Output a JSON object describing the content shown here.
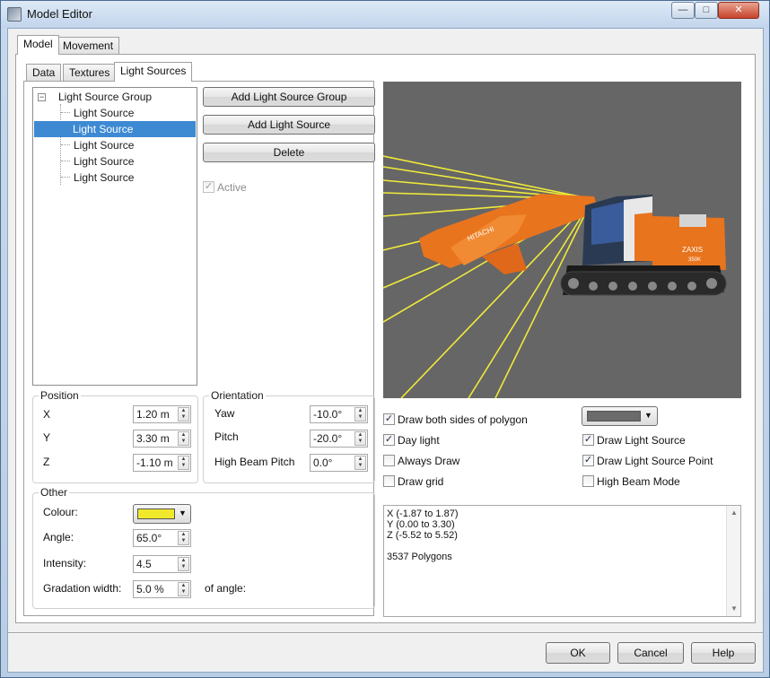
{
  "window": {
    "title": "Model Editor",
    "minimize_glyph": "—",
    "maximize_glyph": "□",
    "close_glyph": "✕"
  },
  "top_tabs": [
    {
      "label": "Model",
      "active": true
    },
    {
      "label": "Movement",
      "active": false
    }
  ],
  "sub_tabs": [
    {
      "label": "Data",
      "active": false
    },
    {
      "label": "Textures",
      "active": false
    },
    {
      "label": "Light Sources",
      "active": true
    }
  ],
  "tree": {
    "root": "Light Source Group",
    "items": [
      "Light Source",
      "Light Source",
      "Light Source",
      "Light Source",
      "Light Source"
    ],
    "selected_index": 1
  },
  "actions": {
    "add_group": "Add Light Source Group",
    "add_source": "Add Light Source",
    "delete": "Delete",
    "active_label": "Active",
    "active_checked": true
  },
  "position": {
    "title": "Position",
    "fields": [
      {
        "label": "X",
        "value": "1.20 m"
      },
      {
        "label": "Y",
        "value": "3.30 m"
      },
      {
        "label": "Z",
        "value": "-1.10 m"
      }
    ]
  },
  "orientation": {
    "title": "Orientation",
    "fields": [
      {
        "label": "Yaw",
        "value": "-10.0°"
      },
      {
        "label": "Pitch",
        "value": "-20.0°"
      },
      {
        "label": "High Beam Pitch",
        "value": "0.0°"
      }
    ]
  },
  "other": {
    "title": "Other",
    "colour_label": "Colour:",
    "colour": "#f0e82a",
    "angle_label": "Angle:",
    "angle_value": "65.0°",
    "intensity_label": "Intensity:",
    "intensity_value": "4.5",
    "gradation_label": "Gradation width:",
    "gradation_value": "5.0 %",
    "gradation_suffix": "of angle:"
  },
  "view": {
    "background": "#666666",
    "bg_color_swatch": "#6b6b6b",
    "options": [
      {
        "label": "Draw both sides of polygon",
        "checked": true
      },
      {
        "label": "Day light",
        "checked": true
      },
      {
        "label": "Always Draw",
        "checked": false
      },
      {
        "label": "Draw grid",
        "checked": false
      },
      {
        "label": "Draw Light Source",
        "checked": true
      },
      {
        "label": "Draw Light Source Point",
        "checked": true
      },
      {
        "label": "High Beam Mode",
        "checked": false
      }
    ],
    "machine_brand": "HITACHI",
    "machine_model": "ZAXIS",
    "machine_sub": "350K"
  },
  "info": {
    "lines": [
      "X (-1.87 to 1.87)",
      "Y (0.00 to 3.30)",
      "Z (-5.52 to 5.52)",
      "",
      "3537 Polygons"
    ]
  },
  "footer": {
    "ok": "OK",
    "cancel": "Cancel",
    "help": "Help"
  }
}
